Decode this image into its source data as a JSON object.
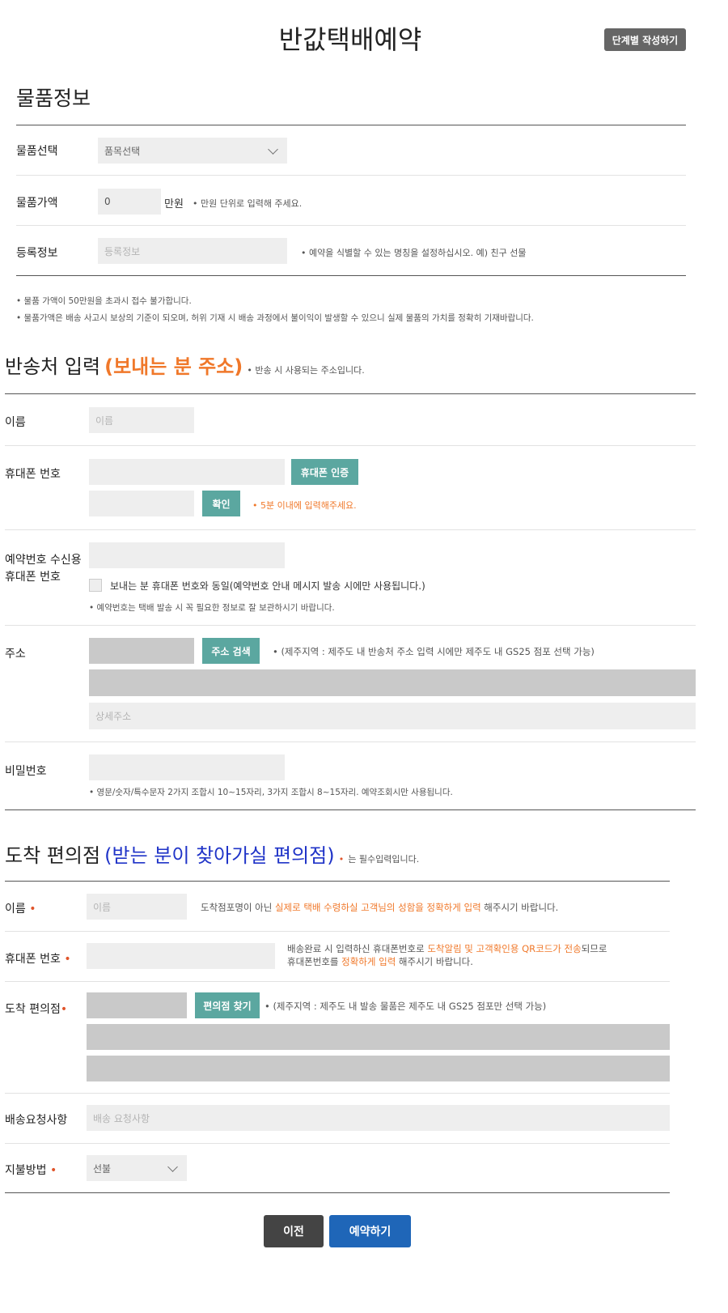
{
  "page": {
    "title": "반값택배예약",
    "step_button": "단계별 작성하기"
  },
  "item_info": {
    "heading": "물품정보",
    "select_label": "물품선택",
    "select_value": "품목선택",
    "price_label": "물품가액",
    "price_value": "0",
    "price_unit": "만원",
    "price_note": "• 만원 단위로 입력해 주세요.",
    "reg_label": "등록정보",
    "reg_placeholder": "등록정보",
    "reg_note": "• 예약을 식별할 수 있는 명칭을 설정하십시오. 예) 친구 선물",
    "notice1": "• 물품 가액이 50만원을 초과시 접수 불가합니다.",
    "notice2": "• 물품가액은 배송 사고시 보상의 기준이 되오며, 허위 기재 시 배송 과정에서 불이익이 발생할 수 있으니 실제 물품의 가치를 정확히 기재바랍니다."
  },
  "sender": {
    "heading": "반송처 입력",
    "heading_sub": "(보내는 분 주소)",
    "heading_note": "• 반송 시 사용되는 주소입니다.",
    "name_label": "이름",
    "name_placeholder": "이름",
    "phone_label": "휴대폰 번호",
    "verify_button": "휴대폰 인증",
    "confirm_button": "확인",
    "confirm_note": "• 5분 이내에 입력해주세요.",
    "recv_label1": "예약번호 수신용",
    "recv_label2": "휴대폰 번호",
    "same_checkbox": "보내는 분 휴대폰 번호와 동일(예약번호 안내 메시지 발송 시에만 사용됩니다.)",
    "recv_note": "• 예약번호는 택배 발송 시 꼭 필요한 정보로 잘 보관하시기 바랍니다.",
    "addr_label": "주소",
    "addr_search_button": "주소 검색",
    "addr_note": "• (제주지역 : 제주도 내 반송처 주소 입력 시에만 제주도 내 GS25 점포 선택 가능)",
    "addr_detail_placeholder": "상세주소",
    "pw_label": "비밀번호",
    "pw_note": "• 영문/숫자/특수문자 2가지 조합시 10~15자리, 3가지 조합시 8~15자리. 예약조회시만 사용됩니다."
  },
  "store": {
    "heading": "도착 편의점",
    "heading_sub": "(받는 분이 찾아가실 편의점)",
    "heading_note_req": "•",
    "heading_note": "는 필수입력입니다.",
    "name_label": "이름",
    "req_mark": "•",
    "name_placeholder": "이름",
    "name_note_a": "도착점포명이 아닌 ",
    "name_note_b": "실제로 택배 수령하실 고객님의 성함을 정확하게 입력",
    "name_note_c": " 해주시기 바랍니다.",
    "phone_label": "휴대폰 번호",
    "phone_note1_a": "배송완료 시 입력하신 휴대폰번호로 ",
    "phone_note1_b": "도착알림 및 고객확인용 QR코드가 전송",
    "phone_note1_c": "되므로",
    "phone_note2_a": "휴대폰번호를 ",
    "phone_note2_b": "정확하게 입력",
    "phone_note2_c": " 해주시기 바랍니다.",
    "store_label": "도착 편의점",
    "find_button": "편의점 찾기",
    "store_note": "• (제주지역 : 제주도 내 발송 물품은 제주도 내 GS25 점포만 선택 가능)",
    "request_label": "배송요청사항",
    "request_placeholder": "배송 요청사항",
    "pay_label": "지불방법",
    "pay_value": "선불"
  },
  "footer": {
    "prev_button": "이전",
    "reserve_button": "예약하기"
  },
  "colors": {
    "teal": "#5ba7a0",
    "orange": "#f0782a",
    "blue": "#2034c8",
    "primary": "#1f66b8",
    "dark": "#444444"
  }
}
